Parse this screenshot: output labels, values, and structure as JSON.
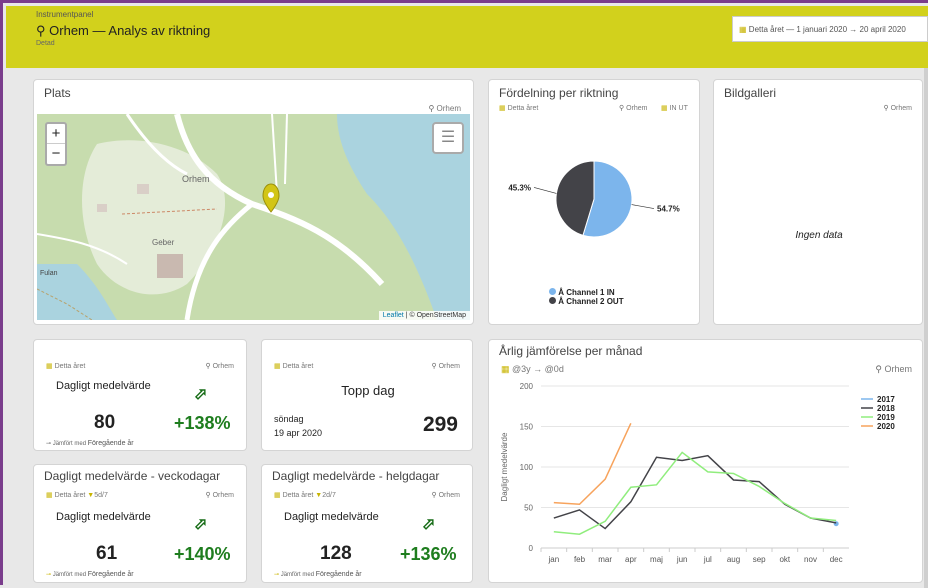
{
  "header": {
    "crumb": "Instrumentpanel",
    "title": "Orhem — Analys av riktning",
    "sub": "Detad",
    "date_text": "Detta året  —  1 januari 2020 → 20 april 2020"
  },
  "map_card": {
    "title": "Plats",
    "location": "Orhem",
    "zoom_in": "+",
    "zoom_out": "−",
    "attribution_leaflet": "Leaflet",
    "attribution_osm": "| © OpenStreetMap",
    "labels": [
      "Orhem",
      "Geber",
      "Fulan"
    ]
  },
  "pie_card": {
    "title": "Fördelning per riktning",
    "period": "Detta året",
    "location": "Orhem",
    "direction": "IN UT",
    "legend": [
      "Channel 1 IN",
      "Channel 2 OUT"
    ],
    "colors": {
      "in": "#7cb5ec",
      "out": "#434348"
    }
  },
  "gallery_card": {
    "title": "Bildgalleri",
    "location": "Orhem",
    "empty": "Ingen data"
  },
  "kpi_daily": {
    "period": "Detta året",
    "location": "Orhem",
    "label": "Dagligt medelvärde",
    "value": "80",
    "change": "+138%",
    "compare": "Jämfört med",
    "compare_target": "Föregående år"
  },
  "kpi_top": {
    "period": "Detta året",
    "location": "Orhem",
    "label": "Topp dag",
    "weekday": "söndag",
    "date": "19 apr 2020",
    "value": "299"
  },
  "kpi_weekday": {
    "title": "Dagligt medelvärde - veckodagar",
    "period": "Detta året",
    "days": "5d/7",
    "location": "Orhem",
    "label": "Dagligt medelvärde",
    "value": "61",
    "change": "+140%",
    "compare": "Jämfört med",
    "compare_target": "Föregående år"
  },
  "kpi_weekend": {
    "title": "Dagligt medelvärde - helgdagar",
    "period": "Detta året",
    "days": "2d/7",
    "location": "Orhem",
    "label": "Dagligt medelvärde",
    "value": "128",
    "change": "+136%",
    "compare": "Jämfört med",
    "compare_target": "Föregående år"
  },
  "line_card": {
    "title": "Årlig jämförelse per månad",
    "range": "@3y → @0d",
    "location": "Orhem"
  },
  "chart_data": [
    {
      "type": "pie",
      "slices": [
        {
          "name": "Channel 1 IN",
          "value": 54.7,
          "label": "54.7%"
        },
        {
          "name": "Channel 2 OUT",
          "value": 45.3,
          "label": "45.3%"
        }
      ]
    },
    {
      "type": "line",
      "categories": [
        "jan",
        "feb",
        "mar",
        "apr",
        "maj",
        "jun",
        "jul",
        "aug",
        "sep",
        "okt",
        "nov",
        "dec"
      ],
      "ylabel": "Dagligt medelvärde",
      "ylim": [
        0,
        200
      ],
      "yticks": [
        0,
        50,
        100,
        150,
        200
      ],
      "series": [
        {
          "name": "2017",
          "color": "#7cb5ec",
          "values": [
            null,
            null,
            null,
            null,
            null,
            null,
            null,
            null,
            null,
            null,
            null,
            30
          ]
        },
        {
          "name": "2018",
          "color": "#434348",
          "values": [
            37,
            47,
            24,
            57,
            112,
            108,
            114,
            84,
            82,
            54,
            37,
            31
          ]
        },
        {
          "name": "2019",
          "color": "#90ed7d",
          "values": [
            20,
            17,
            33,
            75,
            78,
            118,
            94,
            92,
            76,
            55,
            37,
            34
          ]
        },
        {
          "name": "2020",
          "color": "#f7a35c",
          "values": [
            56,
            54,
            85,
            154,
            null,
            null,
            null,
            null,
            null,
            null,
            null,
            null
          ]
        }
      ]
    }
  ]
}
